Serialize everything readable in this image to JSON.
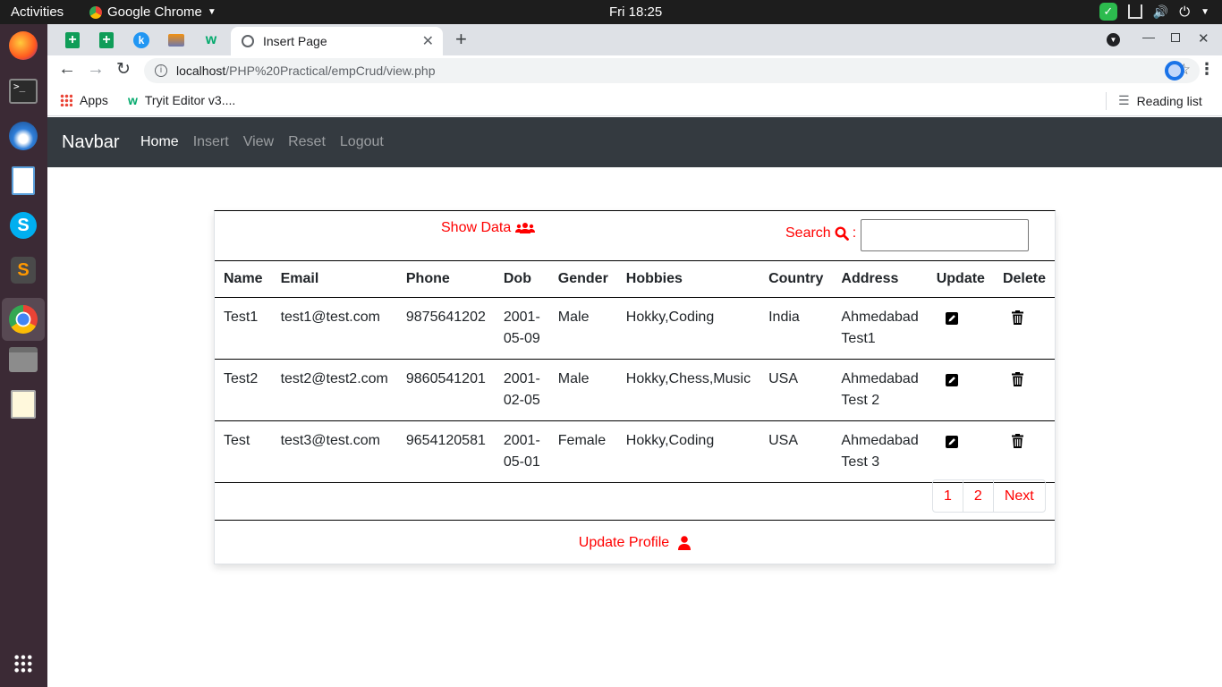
{
  "os": {
    "activities": "Activities",
    "app_menu": "Google Chrome",
    "clock": "Fri 18:25"
  },
  "browser": {
    "tab_title": "Insert Page",
    "url_host": "localhost",
    "url_path": "/PHP%20Practical/empCrud/view.php",
    "bookmarks": {
      "apps": "Apps",
      "tryit": "Tryit Editor v3....",
      "reading_list": "Reading list"
    }
  },
  "navbar": {
    "brand": "Navbar",
    "links": [
      "Home",
      "Insert",
      "View",
      "Reset",
      "Logout"
    ],
    "active": "Home"
  },
  "card": {
    "show_data_label": "Show Data",
    "search_label": "Search",
    "search_colon": ":",
    "search_value": "",
    "columns": [
      "Name",
      "Email",
      "Phone",
      "Dob",
      "Gender",
      "Hobbies",
      "Country",
      "Address",
      "Update",
      "Delete"
    ],
    "rows": [
      {
        "name": "Test1",
        "email": "test1@test.com",
        "phone": "9875641202",
        "dob1": "2001-",
        "dob2": "05-09",
        "gender": "Male",
        "hobbies": "Hokky,Coding",
        "country": "India",
        "address1": "Ahmedabad",
        "address2": "Test1"
      },
      {
        "name": "Test2",
        "email": "test2@test2.com",
        "phone": "9860541201",
        "dob1": "2001-",
        "dob2": "02-05",
        "gender": "Male",
        "hobbies": "Hokky,Chess,Music",
        "country": "USA",
        "address1": "Ahmedabad",
        "address2": "Test 2"
      },
      {
        "name": "Test",
        "email": "test3@test.com",
        "phone": "9654120581",
        "dob1": "2001-",
        "dob2": "05-01",
        "gender": "Female",
        "hobbies": "Hokky,Coding",
        "country": "USA",
        "address1": "Ahmedabad",
        "address2": "Test 3"
      }
    ],
    "pagination": [
      "1",
      "2",
      "Next"
    ],
    "update_profile_label": "Update Profile"
  },
  "colors": {
    "accent": "#ff0000",
    "navbar_bg": "#343a40",
    "dock_bg": "#3b2a35",
    "topbar_bg": "#1d1d1d"
  }
}
